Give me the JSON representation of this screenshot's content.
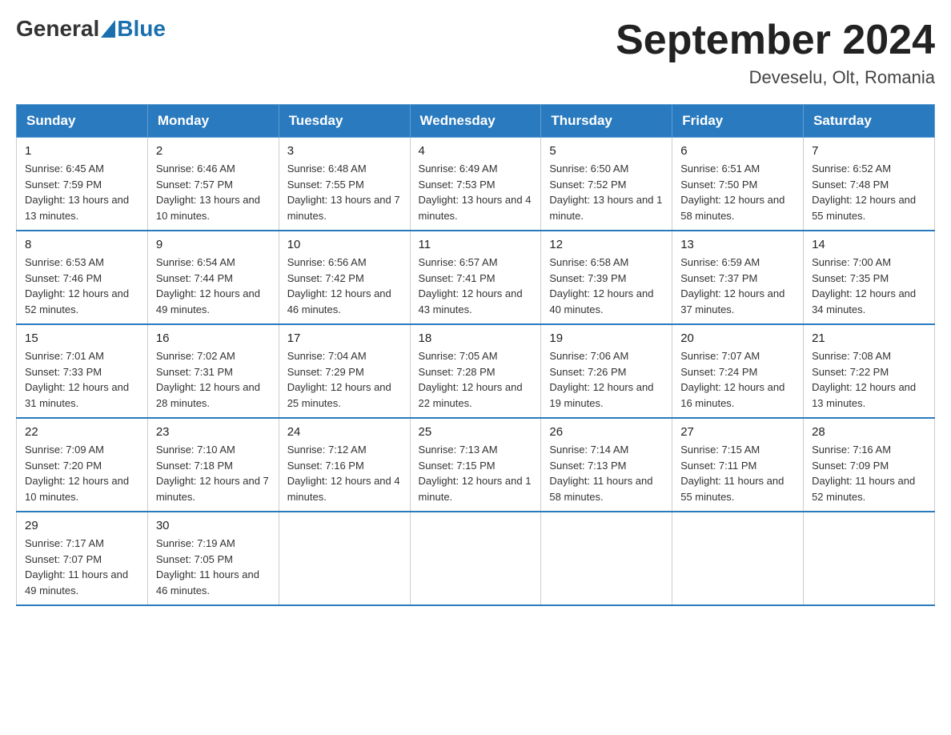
{
  "header": {
    "logo_general": "General",
    "logo_blue": "Blue",
    "month_year": "September 2024",
    "location": "Deveselu, Olt, Romania"
  },
  "weekdays": [
    "Sunday",
    "Monday",
    "Tuesday",
    "Wednesday",
    "Thursday",
    "Friday",
    "Saturday"
  ],
  "weeks": [
    [
      {
        "day": "1",
        "sunrise": "6:45 AM",
        "sunset": "7:59 PM",
        "daylight": "13 hours and 13 minutes."
      },
      {
        "day": "2",
        "sunrise": "6:46 AM",
        "sunset": "7:57 PM",
        "daylight": "13 hours and 10 minutes."
      },
      {
        "day": "3",
        "sunrise": "6:48 AM",
        "sunset": "7:55 PM",
        "daylight": "13 hours and 7 minutes."
      },
      {
        "day": "4",
        "sunrise": "6:49 AM",
        "sunset": "7:53 PM",
        "daylight": "13 hours and 4 minutes."
      },
      {
        "day": "5",
        "sunrise": "6:50 AM",
        "sunset": "7:52 PM",
        "daylight": "13 hours and 1 minute."
      },
      {
        "day": "6",
        "sunrise": "6:51 AM",
        "sunset": "7:50 PM",
        "daylight": "12 hours and 58 minutes."
      },
      {
        "day": "7",
        "sunrise": "6:52 AM",
        "sunset": "7:48 PM",
        "daylight": "12 hours and 55 minutes."
      }
    ],
    [
      {
        "day": "8",
        "sunrise": "6:53 AM",
        "sunset": "7:46 PM",
        "daylight": "12 hours and 52 minutes."
      },
      {
        "day": "9",
        "sunrise": "6:54 AM",
        "sunset": "7:44 PM",
        "daylight": "12 hours and 49 minutes."
      },
      {
        "day": "10",
        "sunrise": "6:56 AM",
        "sunset": "7:42 PM",
        "daylight": "12 hours and 46 minutes."
      },
      {
        "day": "11",
        "sunrise": "6:57 AM",
        "sunset": "7:41 PM",
        "daylight": "12 hours and 43 minutes."
      },
      {
        "day": "12",
        "sunrise": "6:58 AM",
        "sunset": "7:39 PM",
        "daylight": "12 hours and 40 minutes."
      },
      {
        "day": "13",
        "sunrise": "6:59 AM",
        "sunset": "7:37 PM",
        "daylight": "12 hours and 37 minutes."
      },
      {
        "day": "14",
        "sunrise": "7:00 AM",
        "sunset": "7:35 PM",
        "daylight": "12 hours and 34 minutes."
      }
    ],
    [
      {
        "day": "15",
        "sunrise": "7:01 AM",
        "sunset": "7:33 PM",
        "daylight": "12 hours and 31 minutes."
      },
      {
        "day": "16",
        "sunrise": "7:02 AM",
        "sunset": "7:31 PM",
        "daylight": "12 hours and 28 minutes."
      },
      {
        "day": "17",
        "sunrise": "7:04 AM",
        "sunset": "7:29 PM",
        "daylight": "12 hours and 25 minutes."
      },
      {
        "day": "18",
        "sunrise": "7:05 AM",
        "sunset": "7:28 PM",
        "daylight": "12 hours and 22 minutes."
      },
      {
        "day": "19",
        "sunrise": "7:06 AM",
        "sunset": "7:26 PM",
        "daylight": "12 hours and 19 minutes."
      },
      {
        "day": "20",
        "sunrise": "7:07 AM",
        "sunset": "7:24 PM",
        "daylight": "12 hours and 16 minutes."
      },
      {
        "day": "21",
        "sunrise": "7:08 AM",
        "sunset": "7:22 PM",
        "daylight": "12 hours and 13 minutes."
      }
    ],
    [
      {
        "day": "22",
        "sunrise": "7:09 AM",
        "sunset": "7:20 PM",
        "daylight": "12 hours and 10 minutes."
      },
      {
        "day": "23",
        "sunrise": "7:10 AM",
        "sunset": "7:18 PM",
        "daylight": "12 hours and 7 minutes."
      },
      {
        "day": "24",
        "sunrise": "7:12 AM",
        "sunset": "7:16 PM",
        "daylight": "12 hours and 4 minutes."
      },
      {
        "day": "25",
        "sunrise": "7:13 AM",
        "sunset": "7:15 PM",
        "daylight": "12 hours and 1 minute."
      },
      {
        "day": "26",
        "sunrise": "7:14 AM",
        "sunset": "7:13 PM",
        "daylight": "11 hours and 58 minutes."
      },
      {
        "day": "27",
        "sunrise": "7:15 AM",
        "sunset": "7:11 PM",
        "daylight": "11 hours and 55 minutes."
      },
      {
        "day": "28",
        "sunrise": "7:16 AM",
        "sunset": "7:09 PM",
        "daylight": "11 hours and 52 minutes."
      }
    ],
    [
      {
        "day": "29",
        "sunrise": "7:17 AM",
        "sunset": "7:07 PM",
        "daylight": "11 hours and 49 minutes."
      },
      {
        "day": "30",
        "sunrise": "7:19 AM",
        "sunset": "7:05 PM",
        "daylight": "11 hours and 46 minutes."
      },
      null,
      null,
      null,
      null,
      null
    ]
  ],
  "labels": {
    "sunrise": "Sunrise:",
    "sunset": "Sunset:",
    "daylight": "Daylight:"
  }
}
